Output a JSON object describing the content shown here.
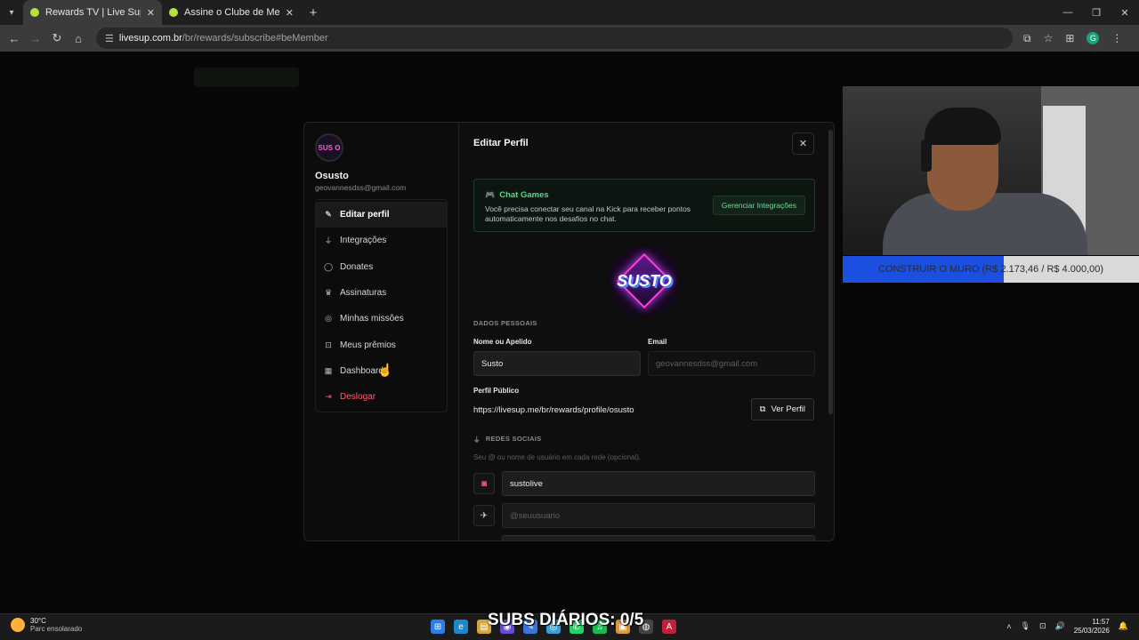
{
  "browser": {
    "tabs": [
      {
        "title": "Rewards TV | Live Sup",
        "active": true
      },
      {
        "title": "Assine o Clube de Membros | Li",
        "active": false
      }
    ],
    "url_host": "livesup.com.br",
    "url_path": "/br/rewards/subscribe#beMember",
    "profile_initial": "G"
  },
  "sidebar": {
    "avatar_text": "SUS O",
    "username": "Osusto",
    "email": "geovannesdss@gmail.com",
    "items": [
      {
        "label": "Editar perfil",
        "icon": "pencil-icon",
        "active": true
      },
      {
        "label": "Integrações",
        "icon": "plug-icon"
      },
      {
        "label": "Donates",
        "icon": "chat-bubble-icon"
      },
      {
        "label": "Assinaturas",
        "icon": "crown-icon"
      },
      {
        "label": "Minhas missões",
        "icon": "target-icon"
      },
      {
        "label": "Meus prêmios",
        "icon": "gift-icon"
      },
      {
        "label": "Dashboard",
        "icon": "grid-icon"
      },
      {
        "label": "Deslogar",
        "icon": "logout-icon",
        "danger": true
      }
    ]
  },
  "main": {
    "title": "Editar Perfil",
    "chat_games": {
      "title": "Chat Games",
      "description": "Você precisa conectar seu canal na Kick para receber pontos automaticamente nos desafios no chat.",
      "button": "Gerenciar Integrações"
    },
    "avatar_text": "SUSTO",
    "personal_section": "DADOS PESSOAIS",
    "name_label": "Nome ou Apelido",
    "name_value": "Susto",
    "email_label": "Email",
    "email_placeholder": "geovannesdss@gmail.com",
    "public_profile_label": "Perfil Público",
    "public_profile_url": "https://livesup.me/br/rewards/profile/osusto",
    "view_profile_button": "Ver Perfil",
    "social_section": "REDES SOCIAIS",
    "social_hint": "Seu @ ou nome de usuário em cada rede (opcional).",
    "instagram_value": "sustolive",
    "twitter_placeholder": "@seuusuario"
  },
  "overlay": {
    "goal_text": "CONSTRUIR O MURO (R$ 2.173,46 / R$ 4.000,00)",
    "goal_fraction": 0.543,
    "subs_text": "SUBS DIÁRIOS: 0/5"
  },
  "taskbar": {
    "temperature": "30°C",
    "weather": "Parc ensolarado",
    "time": "11:57",
    "date": "25/03/2026"
  },
  "colors": {
    "accent_green": "#4ddc8a",
    "danger": "#ff5c6c",
    "goal_fill": "#1b4fe0"
  }
}
